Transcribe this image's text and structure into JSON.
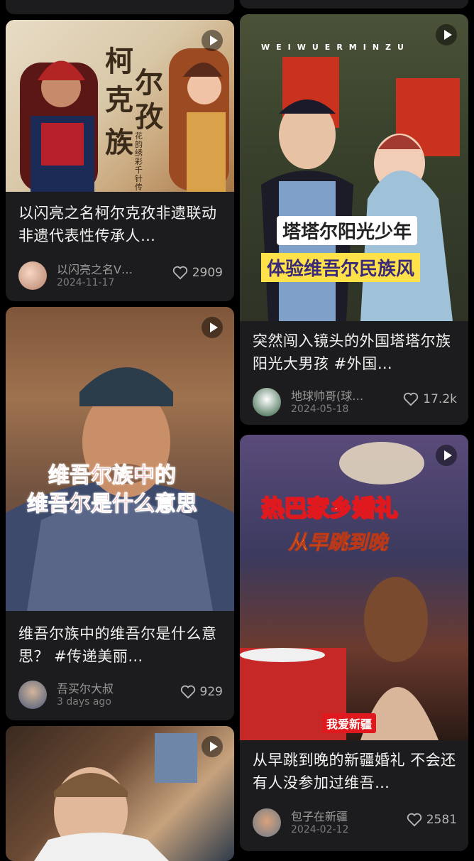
{
  "cards": [
    {
      "title": "以闪亮之名柯尔克孜非遗联动 非遗代表性传承人…",
      "author": "以闪亮之名V…",
      "date": "2024-11-17",
      "likes": "2909",
      "thumb_text": [
        "柯",
        "尔",
        "克",
        "孜",
        "族"
      ],
      "thumb_small": "花韵绣彩 千针传承韵"
    },
    {
      "title": "维吾尔族中的维吾尔是什么意思？ #传递美丽…",
      "author": "吾买尔大叔",
      "date": "3 days ago",
      "likes": "929",
      "thumb_line1": "维吾尔族中的",
      "thumb_line2": "维吾尔是什么意思"
    },
    {
      "title": "",
      "author": "",
      "date": "",
      "likes": ""
    },
    {
      "title": "突然闯入镜头的外国塔塔尔族阳光大男孩 #外国…",
      "author": "地球帅哥(球…",
      "date": "2024-05-18",
      "likes": "17.2k",
      "thumb_banner": "WEIWUERMINZU",
      "thumb_line1": "塔塔尔阳光少年",
      "thumb_line2": "体验维吾尔民族风"
    },
    {
      "title": "从早跳到晚的新疆婚礼 不会还有人没参加过维吾…",
      "author": "包子在新疆",
      "date": "2024-02-12",
      "likes": "2581",
      "thumb_line1": "热巴家乡婚礼",
      "thumb_line2": "从早跳到晚",
      "thumb_tag": "我爱新疆"
    }
  ],
  "colors": {
    "background": "#000000",
    "card": "#1c1c1e",
    "title_text": "#f2f2f2",
    "meta_text": "#9a9a9a",
    "overlay_red": "#e0191e",
    "overlay_yellow": "#ffe14a"
  },
  "icons": [
    "play-icon",
    "heart-icon",
    "avatar"
  ]
}
